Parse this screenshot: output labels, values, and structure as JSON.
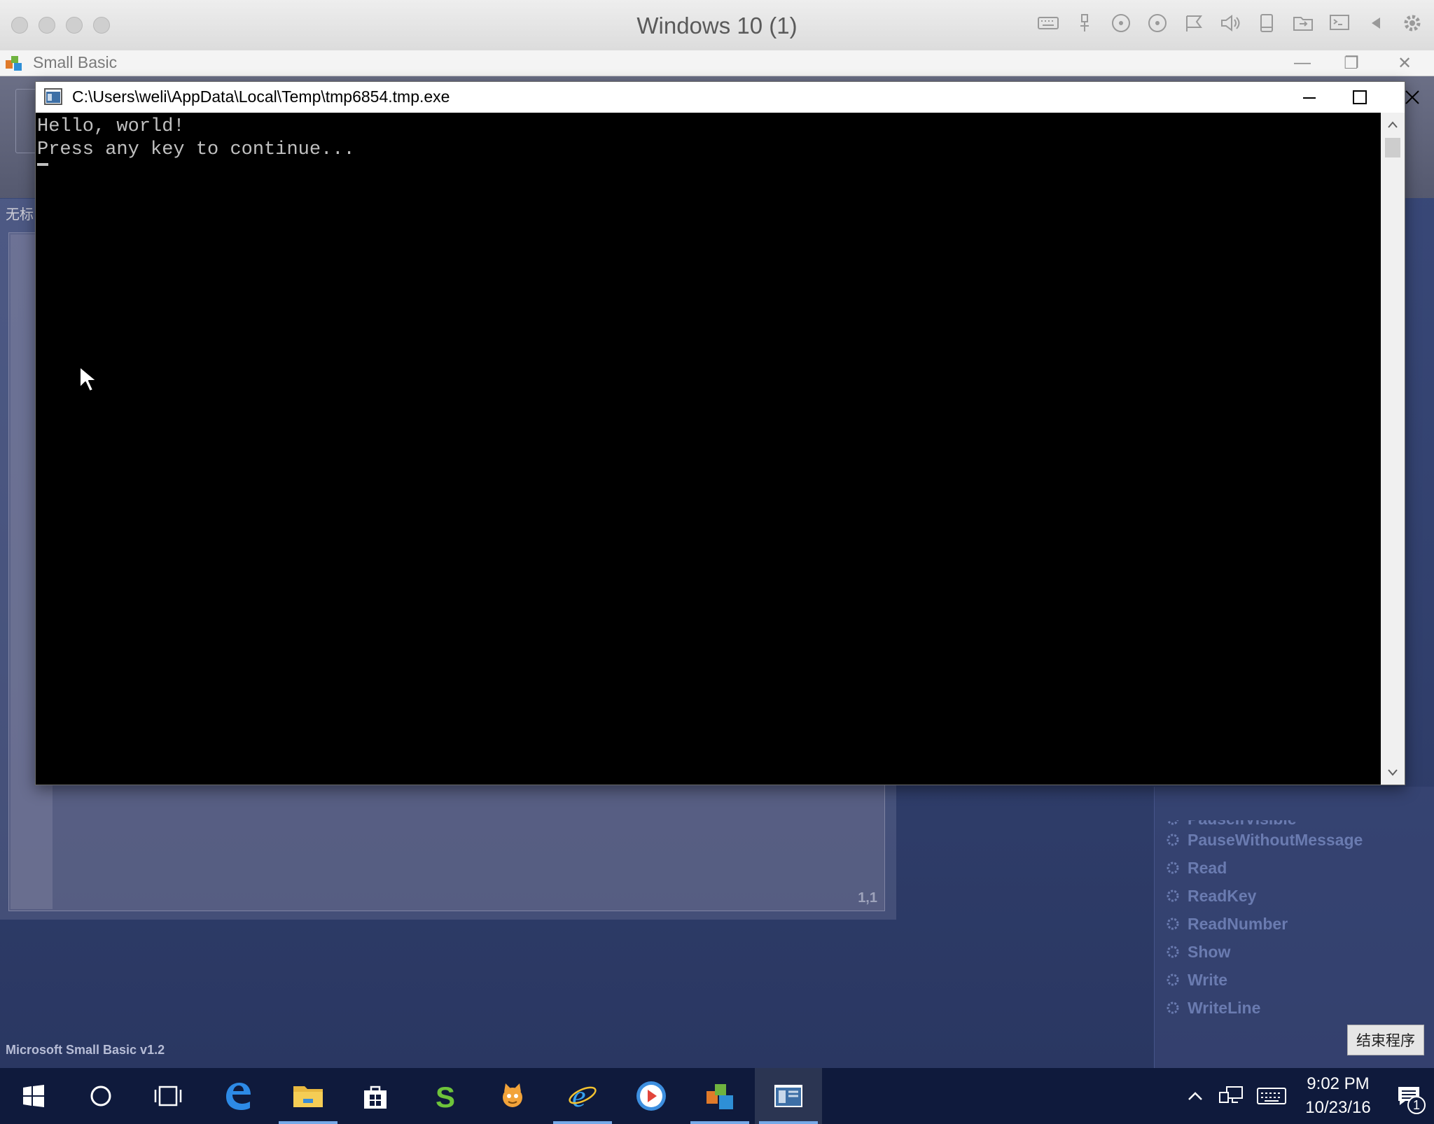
{
  "host": {
    "title": "Windows 10 (1)",
    "icons": [
      "keyboard-icon",
      "usb-icon",
      "cd-icon",
      "cd2-icon",
      "network-icon",
      "sound-icon",
      "storage-icon",
      "share-icon",
      "display-icon",
      "collapse-icon",
      "settings-gear-icon"
    ]
  },
  "small_basic": {
    "title": "Small Basic",
    "doc_tab": "无标",
    "cursor_position": "1,1",
    "stop_button": "结束程序",
    "footer": "Microsoft Small Basic v1.2",
    "partial_item": "PauseIfVisible",
    "members": [
      "PauseWithoutMessage",
      "Read",
      "ReadKey",
      "ReadNumber",
      "Show",
      "Write",
      "WriteLine"
    ]
  },
  "console": {
    "title": "C:\\Users\\weli\\AppData\\Local\\Temp\\tmp6854.tmp.exe",
    "lines": [
      "Hello, world!",
      "Press any key to continue..."
    ]
  },
  "taskbar": {
    "apps": [
      "start",
      "cortana",
      "task-view",
      "edge",
      "file-explorer",
      "store",
      "s-app",
      "scratch",
      "internet-explorer",
      "media-player",
      "small-basic",
      "console"
    ],
    "time": "9:02 PM",
    "date": "10/23/16",
    "notification_count": "1"
  }
}
